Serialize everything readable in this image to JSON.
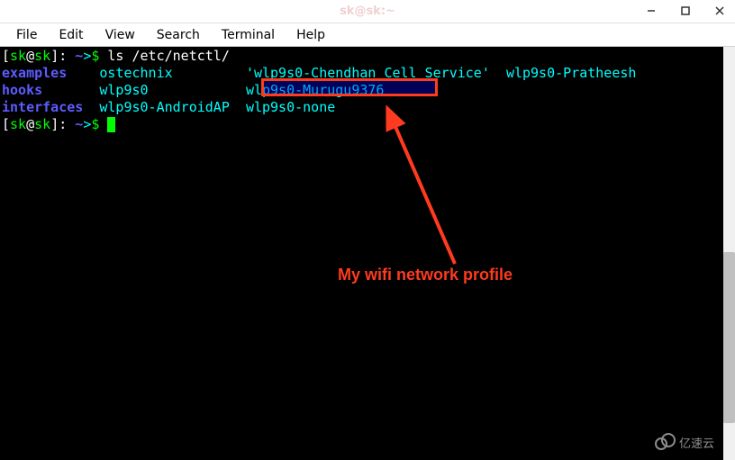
{
  "window": {
    "title": "sk@sk:~"
  },
  "menu": {
    "file": "File",
    "edit": "Edit",
    "view": "View",
    "search": "Search",
    "terminal": "Terminal",
    "help": "Help"
  },
  "prompt": {
    "open_bracket": "[",
    "user": "sk",
    "at": "@",
    "host": "sk",
    "close_bracket": "]",
    "path_sep": ": ",
    "path": "~",
    "arrow": ">",
    "dollar": "$ "
  },
  "command1": "ls /etc/netctl/",
  "listing": {
    "col1": {
      "examples": "examples",
      "hooks": "hooks",
      "interfaces": "interfaces"
    },
    "col2": {
      "ostechnix": "ostechnix",
      "wlp9s0": "wlp9s0",
      "wlp9s0_androidap": "wlp9s0-AndroidAP"
    },
    "col3": {
      "chendhan": "'wlp9s0-Chendhan Cell Service'",
      "murugu": "wlp9s0-Murugu9376",
      "none": "wlp9s0-none"
    },
    "col4": {
      "pratheesh": "wlp9s0-Pratheesh"
    }
  },
  "annotation": {
    "label": "My wifi network profile"
  },
  "watermark_text": "亿速云"
}
